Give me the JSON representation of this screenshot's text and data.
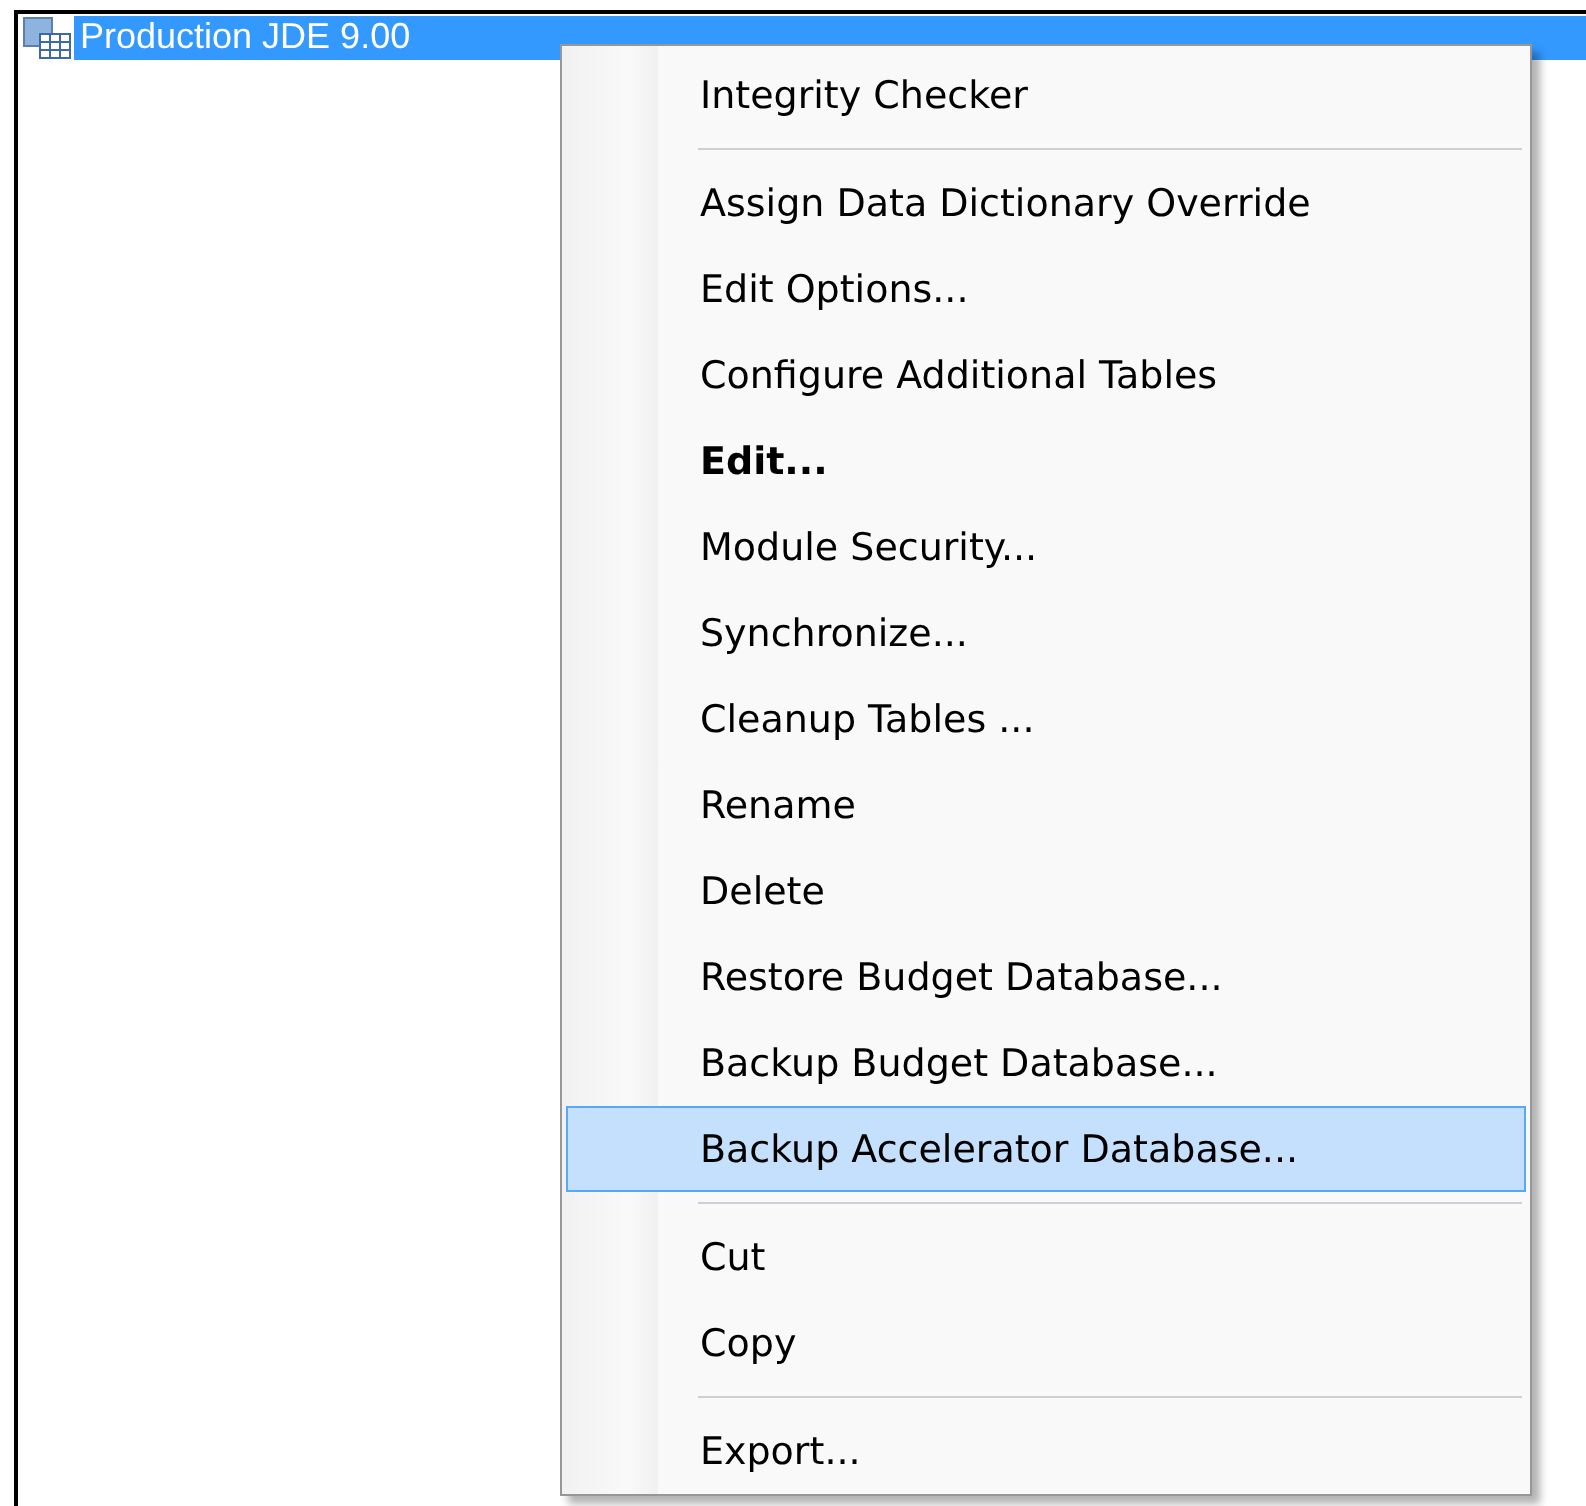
{
  "tree": {
    "row": {
      "label": "Production JDE 9.00",
      "selected": true
    }
  },
  "context_menu": {
    "items": [
      {
        "kind": "item",
        "label": "Integrity Checker",
        "bold": false,
        "selected": false
      },
      {
        "kind": "separator"
      },
      {
        "kind": "item",
        "label": "Assign Data Dictionary Override",
        "bold": false,
        "selected": false
      },
      {
        "kind": "item",
        "label": "Edit Options...",
        "bold": false,
        "selected": false
      },
      {
        "kind": "item",
        "label": "Configure Additional Tables",
        "bold": false,
        "selected": false
      },
      {
        "kind": "item",
        "label": "Edit...",
        "bold": true,
        "selected": false
      },
      {
        "kind": "item",
        "label": "Module Security...",
        "bold": false,
        "selected": false
      },
      {
        "kind": "item",
        "label": "Synchronize...",
        "bold": false,
        "selected": false
      },
      {
        "kind": "item",
        "label": "Cleanup Tables ...",
        "bold": false,
        "selected": false
      },
      {
        "kind": "item",
        "label": "Rename",
        "bold": false,
        "selected": false
      },
      {
        "kind": "item",
        "label": "Delete",
        "bold": false,
        "selected": false
      },
      {
        "kind": "item",
        "label": "Restore Budget Database...",
        "bold": false,
        "selected": false
      },
      {
        "kind": "item",
        "label": "Backup Budget Database...",
        "bold": false,
        "selected": false
      },
      {
        "kind": "item",
        "label": "Backup Accelerator Database...",
        "bold": false,
        "selected": true
      },
      {
        "kind": "separator"
      },
      {
        "kind": "item",
        "label": "Cut",
        "bold": false,
        "selected": false
      },
      {
        "kind": "item",
        "label": "Copy",
        "bold": false,
        "selected": false
      },
      {
        "kind": "separator"
      },
      {
        "kind": "item",
        "label": "Export...",
        "bold": false,
        "selected": false
      }
    ]
  }
}
